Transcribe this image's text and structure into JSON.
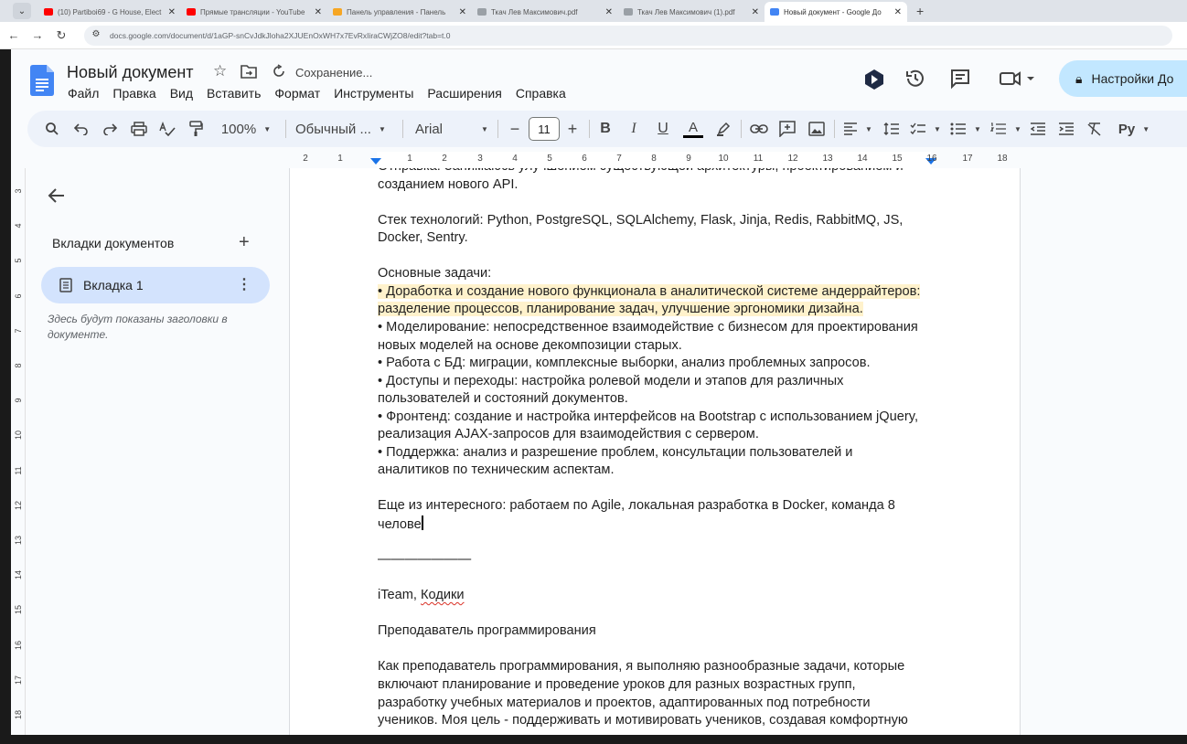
{
  "browser": {
    "tabs": [
      {
        "label": "(10) Partiboi69 - G House, Elect",
        "favicon_color": "#ff0000"
      },
      {
        "label": "Прямые трансляции - YouTube",
        "favicon_color": "#ff0000"
      },
      {
        "label": "Панель управления - Панель",
        "favicon_color": "#f6a623"
      },
      {
        "label": "Ткач Лев Максимович.pdf",
        "favicon_color": "#9aa0a6"
      },
      {
        "label": "Ткач Лев Максимович (1).pdf",
        "favicon_color": "#9aa0a6"
      },
      {
        "label": "Новый документ - Google До",
        "favicon_color": "#4285f4"
      }
    ],
    "url": "docs.google.com/document/d/1aGP-snCvJdkJloha2XJUEnOxWH7x7EvRxIiraCWjZO8/edit?tab=t.0"
  },
  "doc": {
    "title": "Новый документ",
    "status": "Сохранение...",
    "menu": [
      "Файл",
      "Правка",
      "Вид",
      "Вставить",
      "Формат",
      "Инструменты",
      "Расширения",
      "Справка"
    ],
    "share_label": "Настройки До"
  },
  "toolbar": {
    "zoom": "100%",
    "style": "Обычный ...",
    "font": "Arial",
    "font_size": "11",
    "input_tools": "Ру"
  },
  "ruler": {
    "ticks": [
      "2",
      "1",
      "1",
      "2",
      "3",
      "4",
      "5",
      "6",
      "7",
      "8",
      "9",
      "10",
      "11",
      "12",
      "13",
      "14",
      "15",
      "16",
      "17",
      "18"
    ],
    "vticks": [
      "3",
      "4",
      "5",
      "6",
      "7",
      "8",
      "9",
      "10",
      "11",
      "12",
      "13",
      "14",
      "15",
      "16",
      "17",
      "18"
    ]
  },
  "sidebar": {
    "title": "Вкладки документов",
    "tab_label": "Вкладка 1",
    "hint": "Здесь будут показаны заголовки в документе."
  },
  "content": {
    "lines": [
      {
        "text": "Отправка: Занимаюсь улучшением существующей архитектуры, проектированием и",
        "clipped": true
      },
      {
        "text": "созданием нового API."
      },
      {
        "text": ""
      },
      {
        "text": "Стек технологий: Python, PostgreSQL, SQLAlchemy, Flask, Jinja, Redis, RabbitMQ, JS,"
      },
      {
        "text": "Docker, Sentry."
      },
      {
        "text": ""
      },
      {
        "text": "Основные задачи:"
      },
      {
        "text": "• Доработка и создание нового функционала в аналитической системе андеррайтеров:",
        "highlight": true
      },
      {
        "text": "разделение процессов, планирование задач, улучшение эргономики дизайна.",
        "highlight": true
      },
      {
        "text": "• Моделирование: непосредственное взаимодействие с бизнесом для проектирования"
      },
      {
        "text": "новых моделей на основе декомпозиции старых."
      },
      {
        "text": "• Работа с БД: миграции, комплексные выборки, анализ проблемных запросов."
      },
      {
        "text": "• Доступы и переходы: настройка ролевой модели и этапов для различных"
      },
      {
        "text": "пользователей и состояний документов."
      },
      {
        "text": "• Фронтенд: создание и настройка интерфейсов на Bootstrap с использованием jQuery,"
      },
      {
        "text": "реализация AJAX-запросов для взаимодействия с сервером."
      },
      {
        "text": "• Поддержка: анализ и разрешение проблем, консультации пользователей и"
      },
      {
        "text": "аналитиков по техническим аспектам."
      },
      {
        "text": ""
      },
      {
        "text": "Еще из интересного: работаем по Agile, локальная разработка в Docker, команда 8"
      },
      {
        "text": "челове",
        "cursor": true
      },
      {
        "text": ""
      },
      {
        "text": "———————"
      },
      {
        "text": ""
      },
      {
        "text": "iTeam, ",
        "squiggle_suffix": "Кодики"
      },
      {
        "text": ""
      },
      {
        "text": "Преподаватель программирования"
      },
      {
        "text": ""
      },
      {
        "text": "Как преподаватель программирования, я выполняю разнообразные задачи, которые"
      },
      {
        "text": "включают планирование и проведение уроков для разных возрастных групп,"
      },
      {
        "text": "разработку учебных материалов и проектов, адаптированных под потребности"
      },
      {
        "text": "учеников. Моя цель - поддерживать и мотивировать учеников, создавая комфортную"
      }
    ]
  }
}
